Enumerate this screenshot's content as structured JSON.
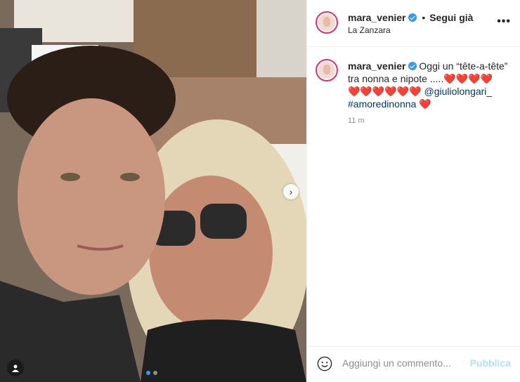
{
  "post": {
    "username": "mara_venier",
    "follow_separator": "•",
    "follow_label": "Segui già",
    "location": "La Zanzara",
    "more_icon": "more-horizontal-icon",
    "caption": {
      "username": "mara_venier",
      "text_1": " Oggi un “tête-a-tête” tra nonna e nipote .....",
      "hearts_1": "❤️❤️❤️❤️",
      "hearts_2": "❤️❤️❤️❤️❤️❤️",
      "mention": "@giuliolongari_",
      "hashtag": "#amoredinonna",
      "hearts_3": "❤️"
    },
    "timestamp": "11 m",
    "comment_placeholder": "Aggiungi un commento...",
    "publish_label": "Pubblica",
    "carousel": {
      "count": 2,
      "active": 0
    }
  },
  "colors": {
    "link": "#00376b",
    "verified": "#3897f0",
    "publish_disabled": "#b2dffc",
    "heart": "#ed4956"
  }
}
